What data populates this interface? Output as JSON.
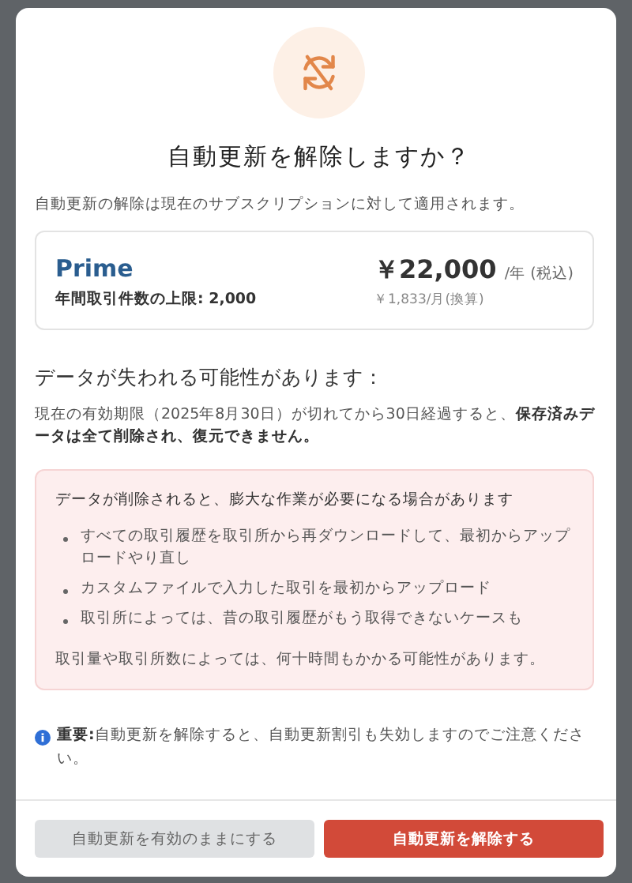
{
  "dialog": {
    "title": "自動更新を解除しますか？",
    "subtitle": "自動更新の解除は現在のサブスクリプションに対して適用されます。",
    "plan": {
      "name": "Prime",
      "limit": "年間取引件数の上限: 2,000",
      "price": "￥22,000",
      "price_unit": "/年 (税込)",
      "monthly": "￥1,833/月(換算)"
    },
    "data_loss": {
      "heading": "データが失われる可能性があります：",
      "text": "現在の有効期限（2025年8月30日）が切れてから30日経過すると、**保存済みデータは全て削除され、復元できません。**"
    },
    "warning": {
      "heading": "データが削除されると、膨大な作業が必要になる場合があります",
      "items": [
        "すべての取引履歴を取引所から再ダウンロードして、最初からアップロードやり直し",
        "カスタムファイルで入力した取引を最初からアップロード",
        "取引所によっては、昔の取引履歴がもう取得できないケースも"
      ],
      "footer": "取引量や取引所数によっては、何十時間もかかる可能性があります。"
    },
    "note": "**重要:**自動更新を解除すると、自動更新割引も失効しますのでご注意ください。",
    "buttons": [
      {
        "label": "自動更新を有効のままにする",
        "kind": "secondary"
      },
      {
        "label": "自動更新を解除する",
        "kind": "danger"
      }
    ]
  }
}
